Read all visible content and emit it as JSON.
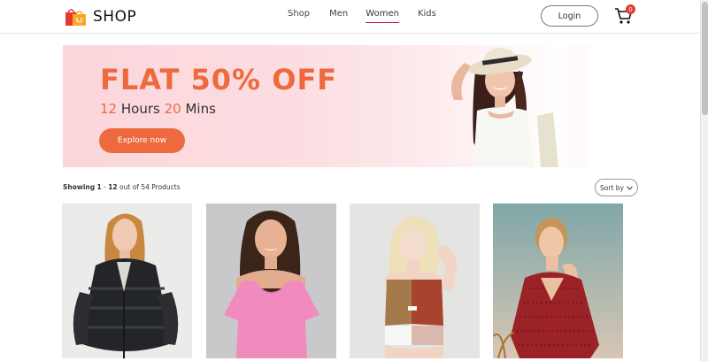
{
  "header": {
    "logo_text": "SHOP",
    "logo_icon": "shopping-bag-icon",
    "nav": [
      {
        "label": "Shop",
        "active": false
      },
      {
        "label": "Men",
        "active": false
      },
      {
        "label": "Women",
        "active": true
      },
      {
        "label": "Kids",
        "active": false
      }
    ],
    "login_label": "Login",
    "cart_icon": "cart-icon",
    "cart_count": "0"
  },
  "banner": {
    "title": "FLAT 50% OFF",
    "timer": {
      "hours": "12",
      "hours_label": "Hours",
      "mins": "20",
      "mins_label": "Mins"
    },
    "cta_label": "Explore now",
    "accent_color": "#ee6a3e"
  },
  "products": {
    "range_start": "1",
    "range_end": "12",
    "total": "54",
    "showing_label": "Showing",
    "out_of_label": "out of",
    "products_label": "Products",
    "sort_label": "Sort by",
    "items": [
      {
        "image": "woman in black puffer jacket"
      },
      {
        "image": "woman in pink top"
      },
      {
        "image": "woman in color-block sports top"
      },
      {
        "image": "woman in red patterned top"
      }
    ]
  }
}
